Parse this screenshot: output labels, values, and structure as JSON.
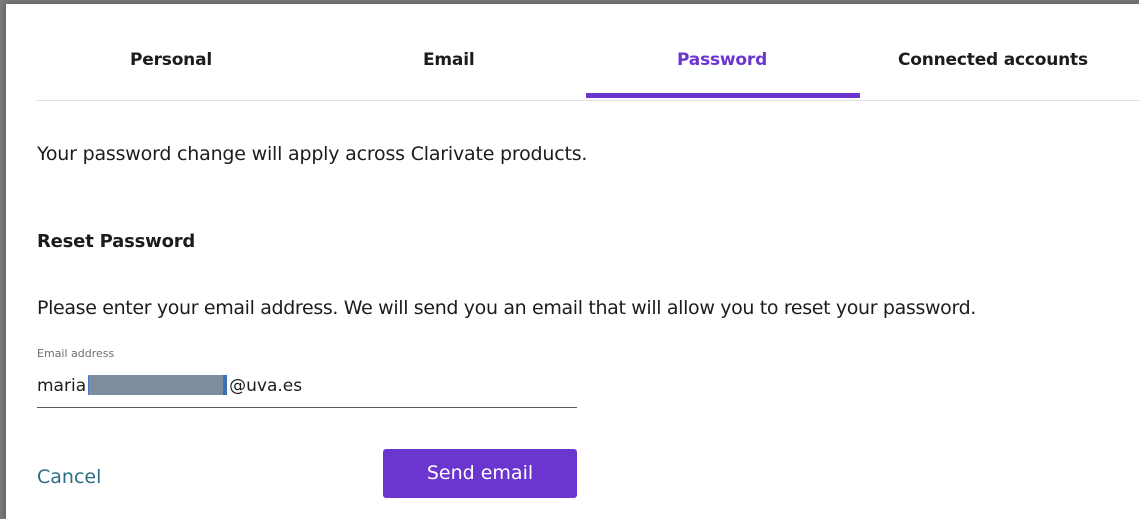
{
  "tabs": [
    {
      "label": "Personal",
      "active": false
    },
    {
      "label": "Email",
      "active": false
    },
    {
      "label": "Password",
      "active": true
    },
    {
      "label": "Connected accounts",
      "active": false
    }
  ],
  "intro_text": "Your password change will apply across Clarivate products.",
  "reset": {
    "title": "Reset Password",
    "instructions": "Please enter your email address. We will send you an email that will allow you to reset your password.",
    "email_field": {
      "label": "Email address",
      "value_prefix": "maria",
      "value_suffix": "@uva.es",
      "redacted": true
    },
    "cancel_label": "Cancel",
    "send_label": "Send email"
  },
  "colors": {
    "accent": "#6b36cf",
    "link": "#2f6d86",
    "text": "#1c1c1c"
  }
}
